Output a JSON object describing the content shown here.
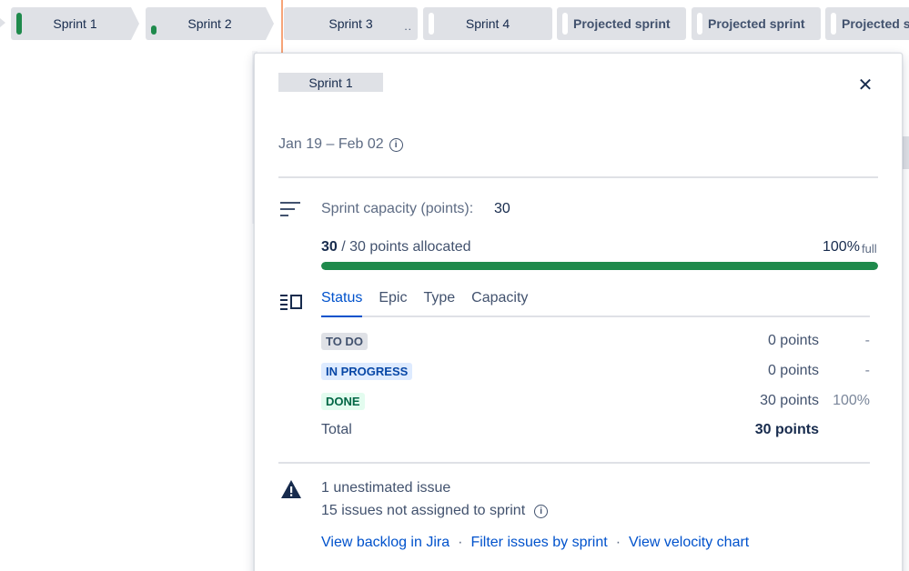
{
  "timeline": {
    "sprints": [
      {
        "label": "Sprint 1"
      },
      {
        "label": "Sprint 2"
      },
      {
        "label": "Sprint 3",
        "tail": ".."
      },
      {
        "label": "Sprint 4"
      },
      {
        "label": "Projected sprint"
      },
      {
        "label": "Projected sprint"
      },
      {
        "label": "Projected s"
      }
    ]
  },
  "popup": {
    "title": "Sprint 1",
    "close_label": "✕",
    "dates": "Jan 19 – Feb 02",
    "capacity": {
      "label": "Sprint capacity (points):",
      "value": "30"
    },
    "allocation": {
      "allocated": "30",
      "rest": " / 30 points allocated",
      "percent_text": "100%",
      "full_text": "full",
      "fill_percent": 100
    },
    "tabs": [
      "Status",
      "Epic",
      "Type",
      "Capacity"
    ],
    "active_tab": "Status",
    "statuses": [
      {
        "label": "TO DO",
        "points": "0 points",
        "pct": "-"
      },
      {
        "label": "IN PROGRESS",
        "points": "0 points",
        "pct": "-"
      },
      {
        "label": "DONE",
        "points": "30 points",
        "pct": "100%"
      }
    ],
    "total": {
      "label": "Total",
      "points": "30 points"
    },
    "warnings": {
      "unestimated": "1 unestimated issue",
      "unassigned": "15 issues not assigned to sprint"
    },
    "links": [
      "View backlog in Jira",
      "Filter issues by sprint",
      "View velocity chart"
    ],
    "link_separator": "·"
  },
  "colors": {
    "accent": "#0052cc",
    "done_green": "#1f8a4c",
    "today_line": "#f7a478"
  },
  "icons": [
    "info-icon",
    "capacity-icon",
    "breakdown-icon",
    "warning-icon",
    "close-icon"
  ]
}
